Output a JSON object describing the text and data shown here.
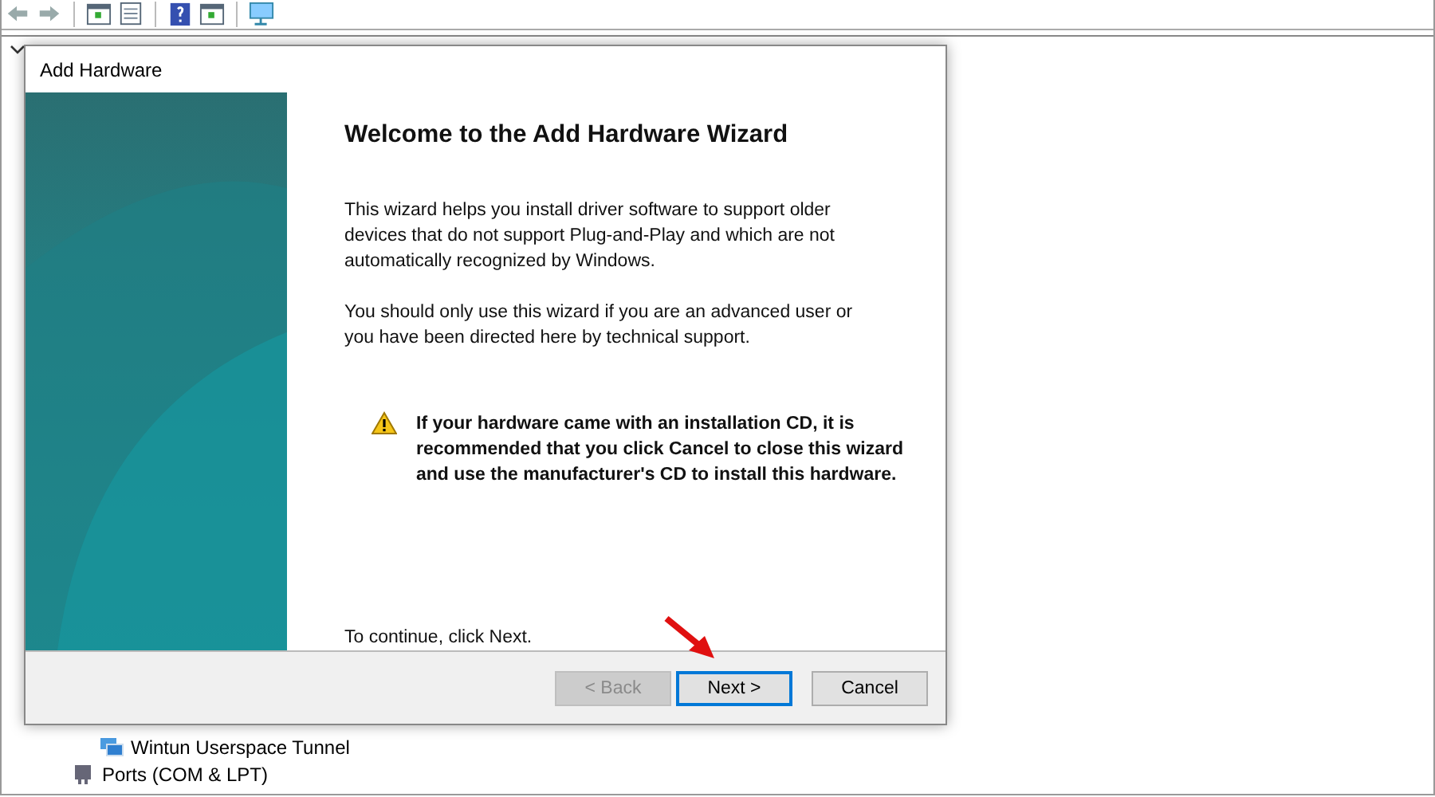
{
  "background_window": {
    "tree_items": [
      {
        "label": "Wintun Userspace Tunnel",
        "kind": "child"
      },
      {
        "label": "Ports (COM & LPT)",
        "kind": "group"
      }
    ]
  },
  "dialog": {
    "title": "Add Hardware",
    "heading": "Welcome to the Add Hardware Wizard",
    "paragraphs": [
      "This wizard helps you install driver software to support older devices that do not support Plug-and-Play and which are not automatically recognized by Windows.",
      "You should only use this wizard if you are an advanced user or you have been directed here by technical support."
    ],
    "warning": "If your hardware came with an installation CD, it is recommended that you click Cancel to close this wizard and use the manufacturer's CD to install this hardware.",
    "continue_text": "To continue, click Next.",
    "buttons": [
      {
        "label": "< Back",
        "disabled": true,
        "focused": false
      },
      {
        "label": "Next >",
        "disabled": false,
        "focused": true
      },
      {
        "label": "Cancel",
        "disabled": false,
        "focused": false
      }
    ]
  }
}
